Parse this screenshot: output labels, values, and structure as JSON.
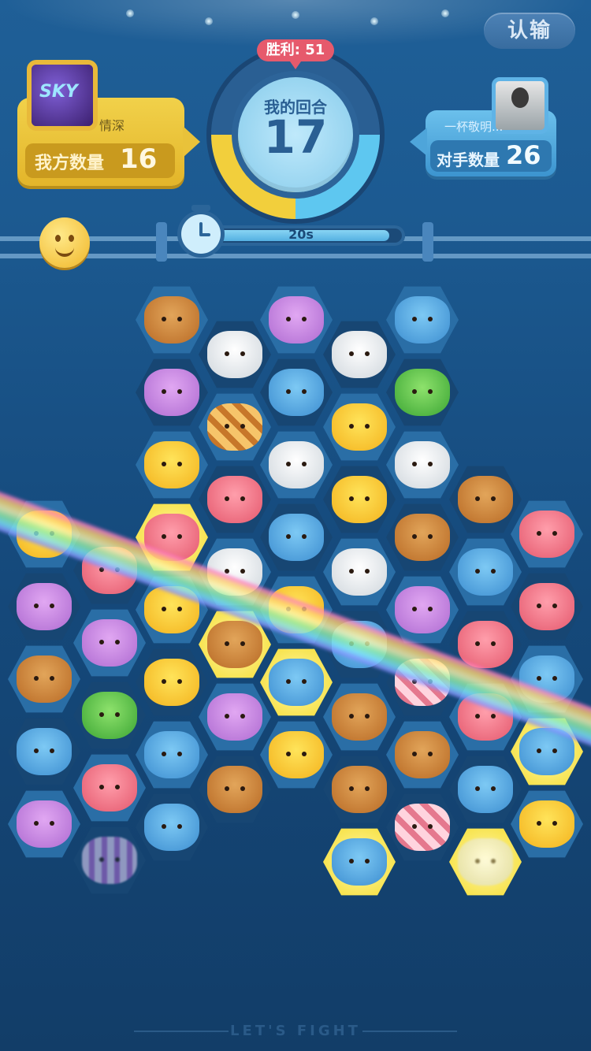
{
  "header": {
    "surrender_label": "认输",
    "wins_label": "胜利: 51",
    "turn_title": "我的回合",
    "turn_count": "17",
    "timer_label": "20s",
    "timer_fraction": 0.95
  },
  "me": {
    "name": "情深",
    "count_label": "我方数量",
    "count_value": "16",
    "avatar_text": "SKY"
  },
  "opponent": {
    "name": "一杯敬明...",
    "count_label": "对手数量",
    "count_value": "26"
  },
  "footer": {
    "text": "LET'S FIGHT"
  },
  "board": {
    "pieces": [
      "bear",
      "cat",
      "panda",
      "cloud",
      "frog",
      "chick",
      "pig",
      "tiger",
      "candy",
      "stripes"
    ]
  }
}
